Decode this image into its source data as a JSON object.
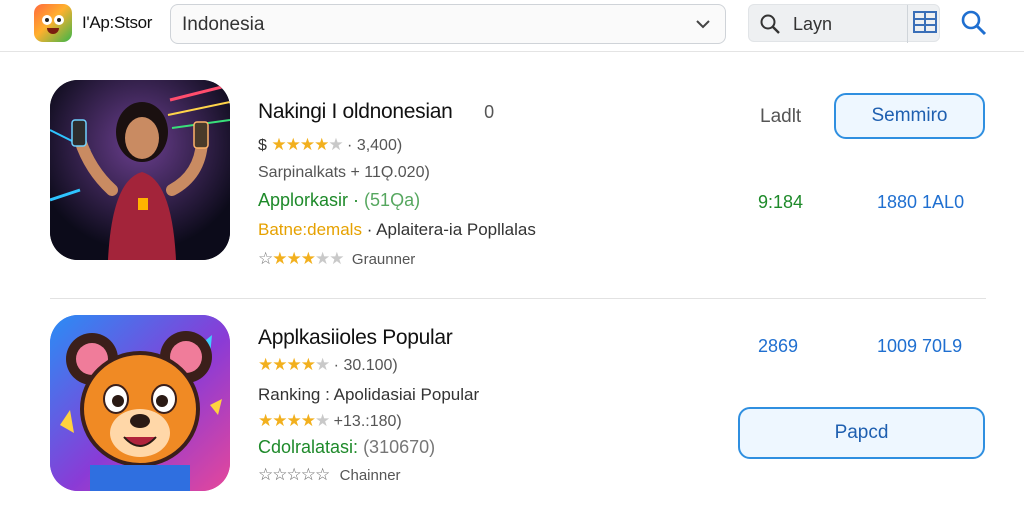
{
  "header": {
    "store_name": "I'Ap:Stsor",
    "country": "Indonesia",
    "search_text": "Layn"
  },
  "rows": [
    {
      "title": "Nakingi I oldnonesian",
      "title_badge": "0",
      "rating_prefix": "$",
      "rating_value": "3,400)",
      "stars_filled": 4.5,
      "subtitle": "Sarpinalkats + 11Ǫ.020)",
      "category_label": "Applorkasir ·",
      "category_value": "(51Ǫa)",
      "ranking_label": "Batne:demals",
      "ranking_value": "Aplaitera-ia Popllalas",
      "secondary_stars": 3,
      "secondary_label": "Graunner",
      "status_label": "Ladlt",
      "button_label": "Semmiro",
      "stat_left": "9:184",
      "stat_right": "1880 1AL0"
    },
    {
      "title": "Applkasiioles Popular",
      "rating_value": "30.100)",
      "stars_filled": 3.5,
      "ranking_line": "Ranking : Apolidasiai Popular",
      "rating2_value": "+13.:180)",
      "stars2_filled": 4.5,
      "category_label": "Cdolralatasi:",
      "category_value": "(310670)",
      "hollow_label": "Chainner",
      "stat_left": "2869",
      "stat_right": "1009 70L9",
      "button_label": "Papcd"
    }
  ],
  "colors": {
    "accent_blue": "#1f6fd0",
    "green": "#1e8a2a",
    "star": "#f2b01e",
    "orange": "#e6a100"
  }
}
